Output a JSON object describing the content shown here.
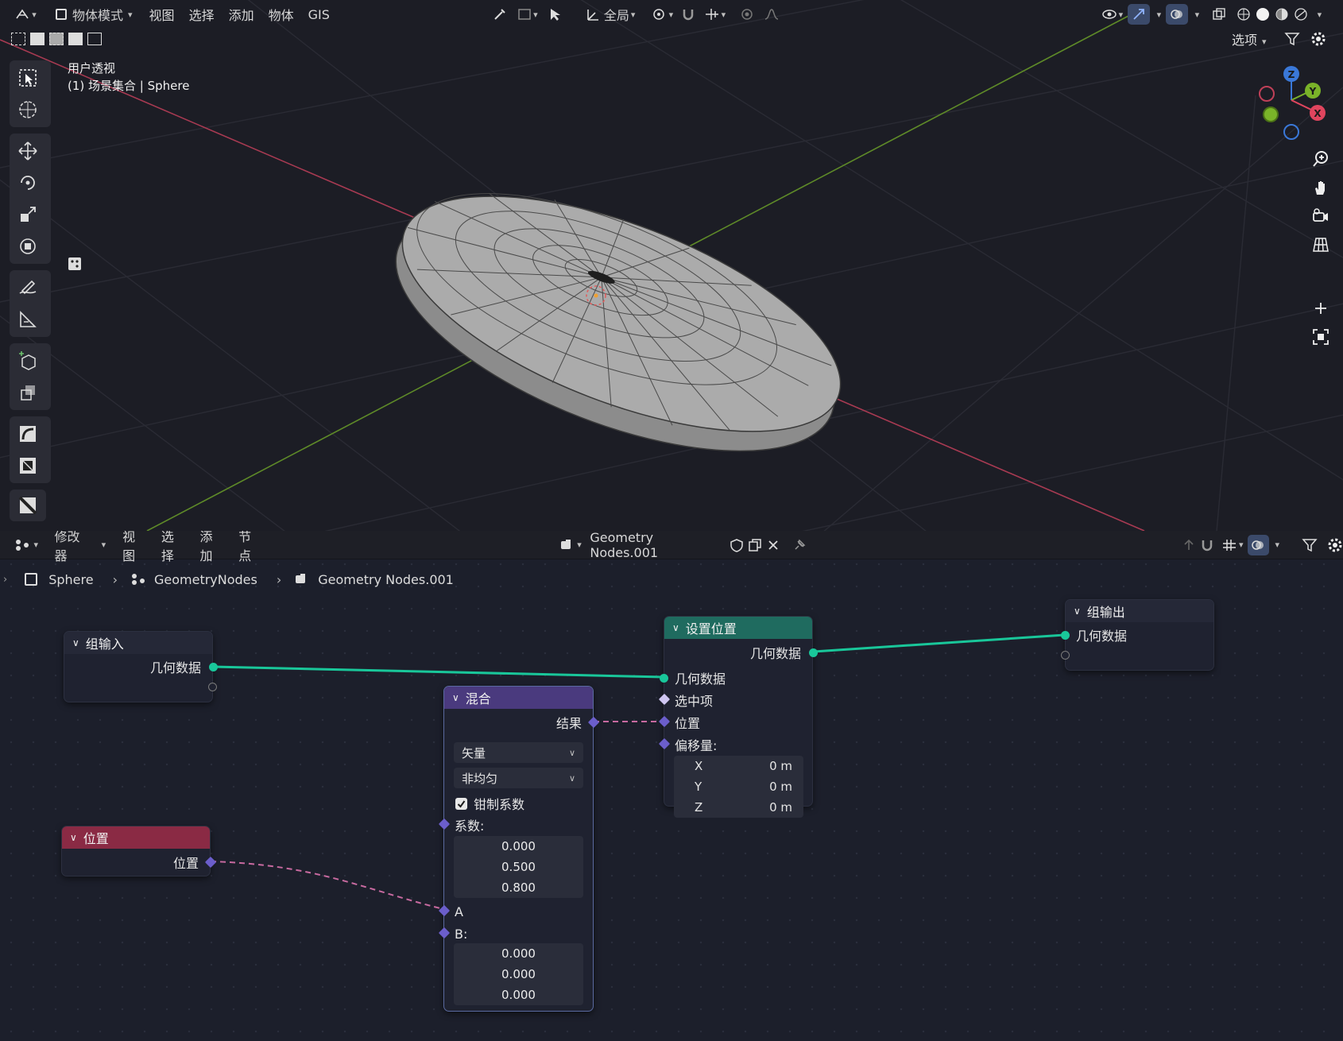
{
  "viewport": {
    "header": {
      "mode_label": "物体模式",
      "menus": [
        "视图",
        "选择",
        "添加",
        "物体",
        "GIS"
      ],
      "transform_orientation": "全局",
      "options_label": "选项"
    },
    "overlay_text": {
      "view_name": "用户透视",
      "collection_info": "(1) 场景集合 | Sphere"
    },
    "gizmo": {
      "z": "Z",
      "y": "Y",
      "x": "X"
    }
  },
  "node_editor": {
    "header": {
      "type_label": "修改器",
      "menus": [
        "视图",
        "选择",
        "添加",
        "节点"
      ],
      "node_tree_name": "Geometry Nodes.001"
    },
    "breadcrumb": [
      "Sphere",
      "GeometryNodes",
      "Geometry Nodes.001"
    ],
    "nodes": {
      "group_input": {
        "title": "组输入",
        "output": "几何数据"
      },
      "set_position": {
        "title": "设置位置",
        "output": "几何数据",
        "inputs": [
          "几何数据",
          "选中项",
          "位置",
          "偏移量:"
        ],
        "offset": [
          {
            "axis": "X",
            "value": "0 m"
          },
          {
            "axis": "Y",
            "value": "0 m"
          },
          {
            "axis": "Z",
            "value": "0 m"
          }
        ]
      },
      "group_output": {
        "title": "组输出",
        "input": "几何数据"
      },
      "mix": {
        "title": "混合",
        "output": "结果",
        "data_type": "矢量",
        "factor_mode": "非均匀",
        "clamp_label": "钳制系数",
        "factor_label": "系数:",
        "factor_values": [
          "0.000",
          "0.500",
          "0.800"
        ],
        "a_label": "A",
        "b_label": "B:",
        "b_values": [
          "0.000",
          "0.000",
          "0.000"
        ]
      },
      "position": {
        "title": "位置",
        "output": "位置"
      }
    }
  },
  "colors": {
    "geometry_socket": "#19c79a",
    "vector_socket": "#6b5ecb",
    "set_position_header": "#1f6b5f",
    "mix_header": "#4a3a7e",
    "position_header": "#8a2a44",
    "x_axis": "#a83a52",
    "y_axis": "#5e8a28"
  }
}
